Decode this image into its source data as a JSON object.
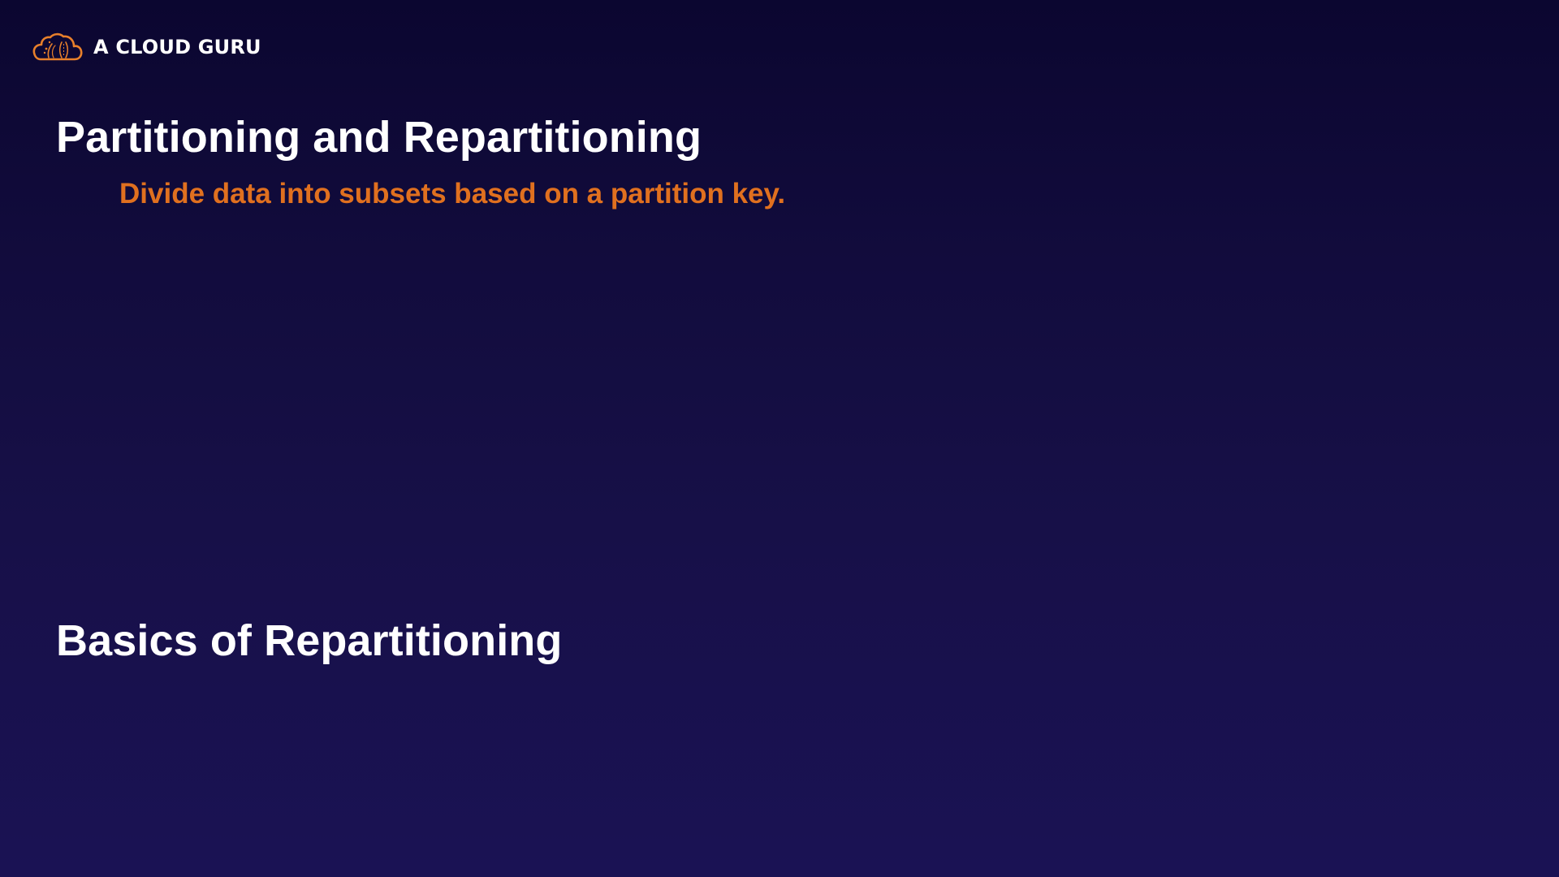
{
  "brand": {
    "name": "A CLOUD GURU",
    "logo_icon": "cloud-logo-icon",
    "logo_color": "#e8802b"
  },
  "slide": {
    "title": "Partitioning and Repartitioning",
    "subtitle": "Divide data into subsets based on a partition key.",
    "subtitle_color": "#e0701f",
    "section_title": "Basics of Repartitioning"
  }
}
